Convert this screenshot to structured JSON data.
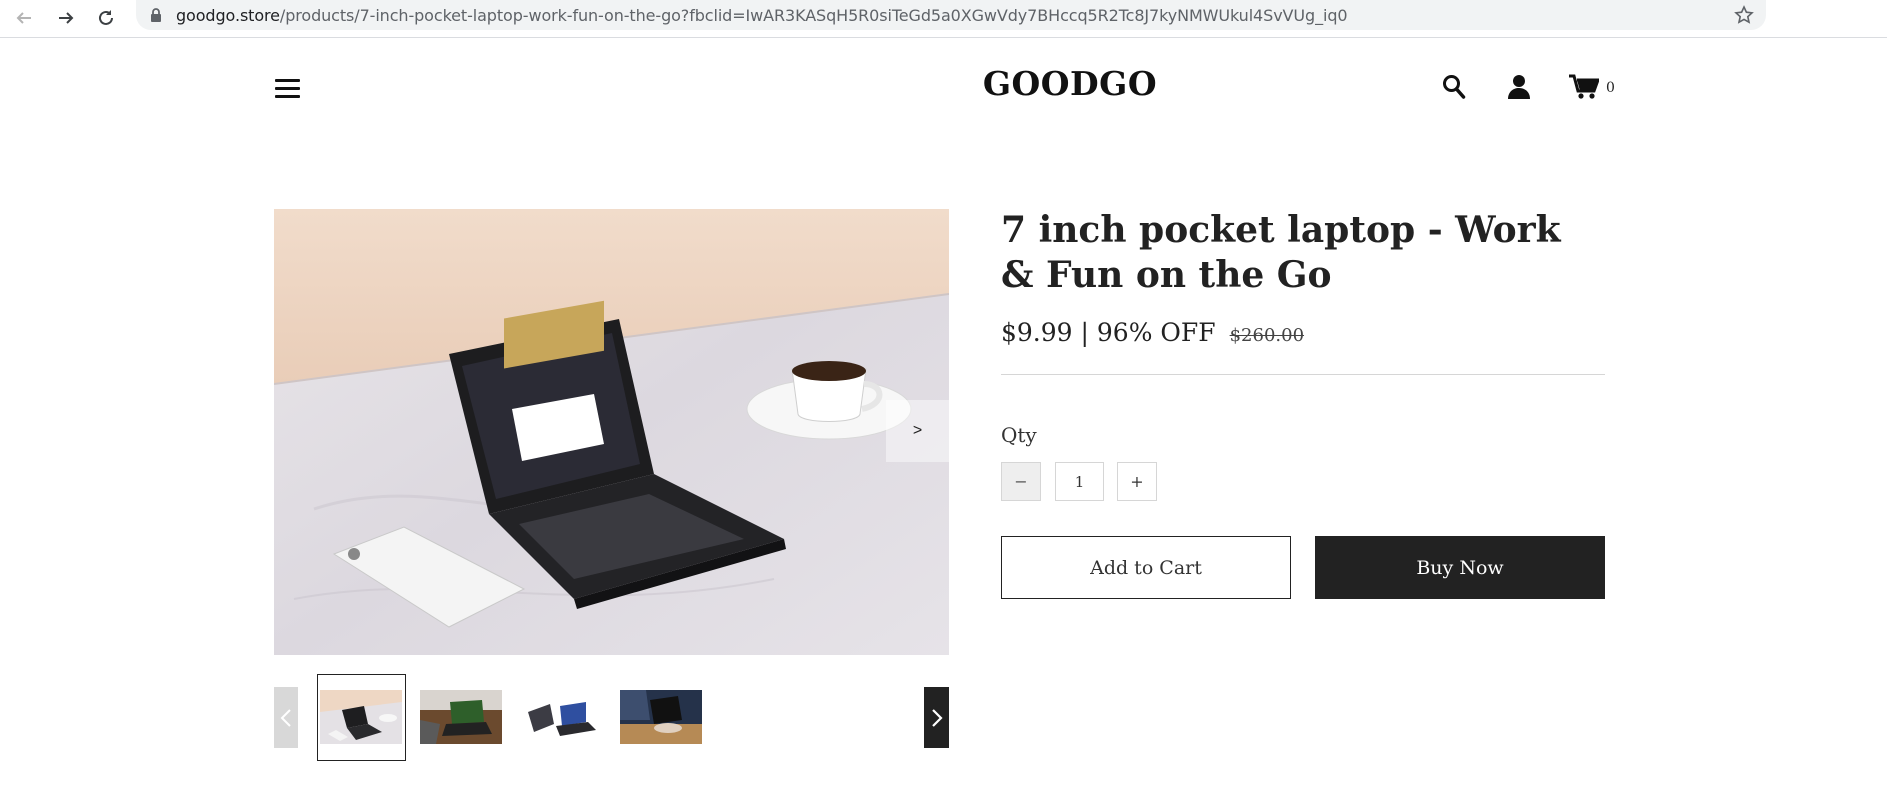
{
  "browser": {
    "url_host": "goodgo.store",
    "url_path": "/products/7-inch-pocket-laptop-work-fun-on-the-go?fbclid=IwAR3KASqH5R0siTeGd5a0XGwVdy7BHccq5R2Tc8J7kyNMWUkul4SvVUg_iq0",
    "icons": [
      "back-arrow-icon",
      "forward-arrow-icon",
      "reload-icon",
      "lock-icon",
      "bookmark-star-icon"
    ]
  },
  "header": {
    "logo": "GOODGO",
    "cart_count": "0",
    "icons": [
      "menu-icon",
      "search-icon",
      "account-icon",
      "cart-icon"
    ]
  },
  "gallery": {
    "next_label": ">",
    "thumbnail_count": 4,
    "selected_thumbnail": 1
  },
  "product": {
    "title": "7 inch pocket laptop - Work & Fun on the Go",
    "price": "$9.99 | 96% OFF",
    "compare_price": "$260.00",
    "qty_label": "Qty",
    "qty_minus": "−",
    "qty_value": "1",
    "qty_plus": "+",
    "add_to_cart": "Add to Cart",
    "buy_now": "Buy Now"
  }
}
